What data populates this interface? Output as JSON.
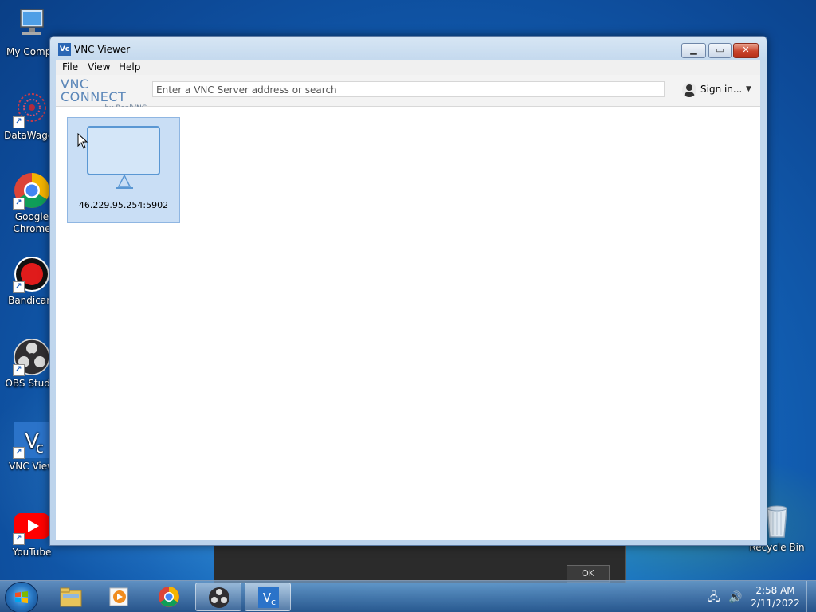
{
  "desktop": {
    "icons": [
      {
        "label": "My Compu",
        "icon": "computer-icon"
      },
      {
        "label": "DataWagon",
        "icon": "datawagon-icon"
      },
      {
        "label": "Google Chrome",
        "icon": "chrome-icon"
      },
      {
        "label": "Bandicam",
        "icon": "bandicam-icon"
      },
      {
        "label": "OBS Studio",
        "icon": "obs-icon"
      },
      {
        "label": "VNC View",
        "icon": "vnc-icon"
      },
      {
        "label": "YouTube",
        "icon": "youtube-icon"
      },
      {
        "label": "Recycle Bin",
        "icon": "recycle-bin-icon"
      }
    ]
  },
  "window": {
    "title": "VNC Viewer",
    "menu": [
      "File",
      "View",
      "Help"
    ],
    "logo": {
      "main": "VNC CONNECT",
      "sub": "by RealVNC"
    },
    "search": {
      "placeholder": "Enter a VNC Server address or search"
    },
    "sign_in": "Sign in...",
    "connections": [
      {
        "address": "46.229.95.254:5902"
      }
    ]
  },
  "background_dialog": {
    "ok_label": "OK"
  },
  "taskbar": {
    "apps": [
      "explorer-icon",
      "media-player-icon",
      "chrome-icon",
      "obs-icon",
      "vnc-icon"
    ],
    "active": "vnc-icon",
    "time": "2:58 AM",
    "date": "2/11/2022"
  },
  "colors": {
    "accent": "#2f6fb3",
    "tile_bg": "#c9def5",
    "close_button": "#c9442c"
  }
}
